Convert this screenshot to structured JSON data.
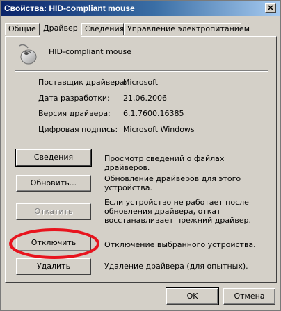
{
  "window": {
    "title": "Свойства: HID-compliant mouse",
    "close_label": "✕"
  },
  "tabs": [
    {
      "label": "Общие"
    },
    {
      "label": "Драйвер"
    },
    {
      "label": "Сведения"
    },
    {
      "label": "Управление электропитанием"
    }
  ],
  "device": {
    "icon": "mouse-icon",
    "name": "HID-compliant mouse"
  },
  "driver_info": [
    {
      "label": "Поставщик драйвера:",
      "value": "Microsoft"
    },
    {
      "label": "Дата разработки:",
      "value": "21.06.2006"
    },
    {
      "label": "Версия драйвера:",
      "value": "6.1.7600.16385"
    },
    {
      "label": "Цифровая подпись:",
      "value": "Microsoft Windows"
    }
  ],
  "actions": [
    {
      "button": "Сведения",
      "description": "Просмотр сведений о файлах драйверов."
    },
    {
      "button": "Обновить...",
      "description": "Обновление драйверов для этого устройства."
    },
    {
      "button": "Откатить",
      "description": "Если устройство не работает после обновления драйвера, откат восстанавливает прежний драйвер."
    },
    {
      "button": "Отключить",
      "description": "Отключение выбранного устройства."
    },
    {
      "button": "Удалить",
      "description": "Удаление драйвера (для опытных)."
    }
  ],
  "footer": {
    "ok": "OK",
    "cancel": "Отмена"
  },
  "colors": {
    "highlight_ellipse": "#e8141e"
  }
}
